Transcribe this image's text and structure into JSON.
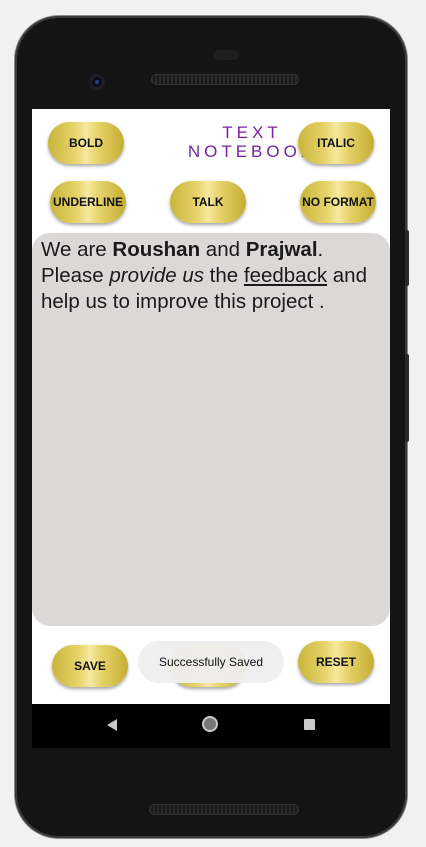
{
  "app": {
    "title": "TEXT NOTEBOOK"
  },
  "format_buttons": {
    "bold": "BOLD",
    "italic": "ITALIC",
    "underline": "UNDERLINE",
    "talk": "TALK",
    "no_format": "NO FORMAT"
  },
  "editor": {
    "segments": [
      {
        "text": " We are ",
        "style": "normal"
      },
      {
        "text": "Roushan",
        "style": "bold"
      },
      {
        "text": " and ",
        "style": "normal"
      },
      {
        "text": "Prajwal",
        "style": "bold"
      },
      {
        "text": ". Please ",
        "style": "normal"
      },
      {
        "text": "provide us",
        "style": "italic"
      },
      {
        "text": " the ",
        "style": "normal"
      },
      {
        "text": "feedback",
        "style": "underline"
      },
      {
        "text": " and help us to improve this project .",
        "style": "normal"
      }
    ]
  },
  "actions": {
    "save": "SAVE",
    "reset": "RESET"
  },
  "toast": {
    "message": "Successfully Saved"
  },
  "colors": {
    "title": "#7a1fa2",
    "button_gold": "#e6d36a",
    "editor_bg": "#dcd8d8"
  }
}
